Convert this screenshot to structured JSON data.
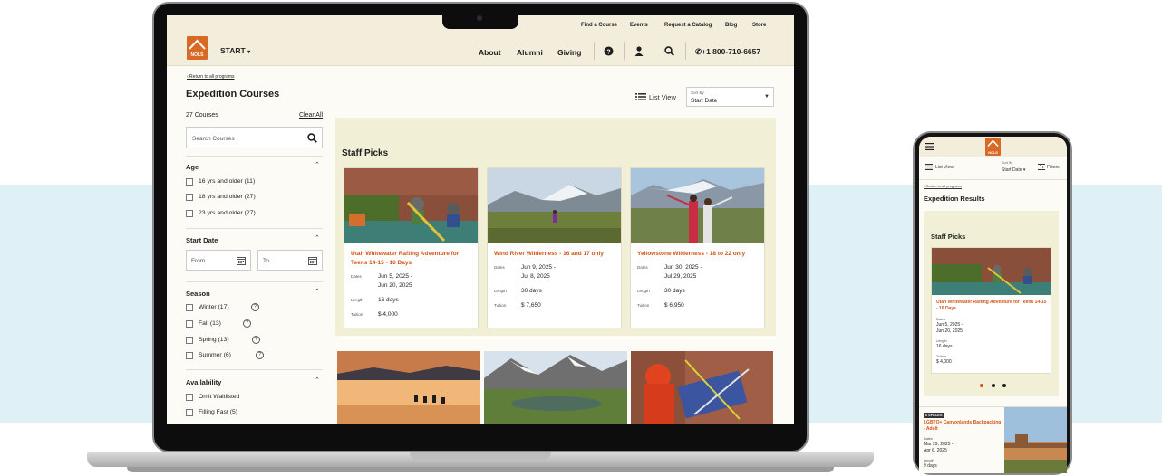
{
  "colors": {
    "accent": "#d2541a",
    "header_bg": "#f3eddc",
    "picks_bg": "#f1f0d6",
    "band": "#dff1f6"
  },
  "utility_nav": [
    "Find a Course",
    "Events",
    "Request a Catalog",
    "Blog",
    "Store"
  ],
  "brand": {
    "logo_text": "NOLS",
    "start_label": "START"
  },
  "main_nav": {
    "about": "About",
    "alumni": "Alumni",
    "giving": "Giving",
    "phone": "+1 800-710-6657"
  },
  "back_link": "‹ Return to all programs",
  "page_title": "Expedition Courses",
  "toolbar": {
    "list_view": "List View",
    "sort_label": "Sort By",
    "sort_value": "Start Date"
  },
  "filters": {
    "count": "27 Courses",
    "clear_all": "Clear All",
    "search_placeholder": "Search Courses",
    "age": {
      "title": "Age",
      "options": [
        "16 yrs and older (11)",
        "18 yrs and older (27)",
        "23 yrs and older (27)"
      ]
    },
    "start_date": {
      "title": "Start Date",
      "from": "From",
      "to": "To"
    },
    "season": {
      "title": "Season",
      "options": [
        "Winter (17)",
        "Fall (13)",
        "Spring (13)",
        "Summer (6)"
      ]
    },
    "availability": {
      "title": "Availability",
      "options": [
        "Omit Waitlisted",
        "Filling Fast (5)"
      ]
    }
  },
  "staff_picks": {
    "title": "Staff Picks",
    "labels": {
      "dates": "Dates",
      "length": "Length",
      "tuition": "Tuition"
    },
    "cards": [
      {
        "title": "Utah Whitewater Rafting Adventure for Teens 14-15 - 16 Days",
        "date_start": "Jun 5, 2025 -",
        "date_end": "Jun 20, 2025",
        "length": "16 days",
        "tuition": "$ 4,000"
      },
      {
        "title": "Wind River Wilderness - 16 and 17 only",
        "date_start": "Jun 9, 2025 -",
        "date_end": "Jul 8, 2025",
        "length": "30 days",
        "tuition": "$ 7,650"
      },
      {
        "title": "Yellowstone Wilderness - 18 to 22 only",
        "date_start": "Jun 30, 2025 -",
        "date_end": "Jul 29, 2025",
        "length": "30 days",
        "tuition": "$ 6,950"
      }
    ]
  },
  "mobile": {
    "logo_text": "NOLS",
    "list_view": "List View",
    "sort_label": "Sort By",
    "sort_value": "Start Date",
    "filters": "Filters",
    "back_link": "‹ Return to all programs",
    "title": "Expedition Results",
    "picks_title": "Staff Picks",
    "card": {
      "title": "Utah Whitewater Rafting Adventure for Teens 14-15 - 16 Days",
      "dates_label": "Dates",
      "date_start": "Jun 5, 2025 -",
      "date_end": "Jun 20, 2025",
      "length_label": "Length",
      "length": "16 days",
      "tuition_label": "Tuition",
      "tuition": "$ 4,000"
    },
    "bottom": {
      "badge": "6 SPACES",
      "title": "LGBTQ+ Canyonlands Backpacking - Adult",
      "dates_label": "Dates",
      "date_start": "Mar 29, 2025 -",
      "date_end": "Apr 6, 2025",
      "length_label": "Length",
      "length": "9 days"
    }
  }
}
